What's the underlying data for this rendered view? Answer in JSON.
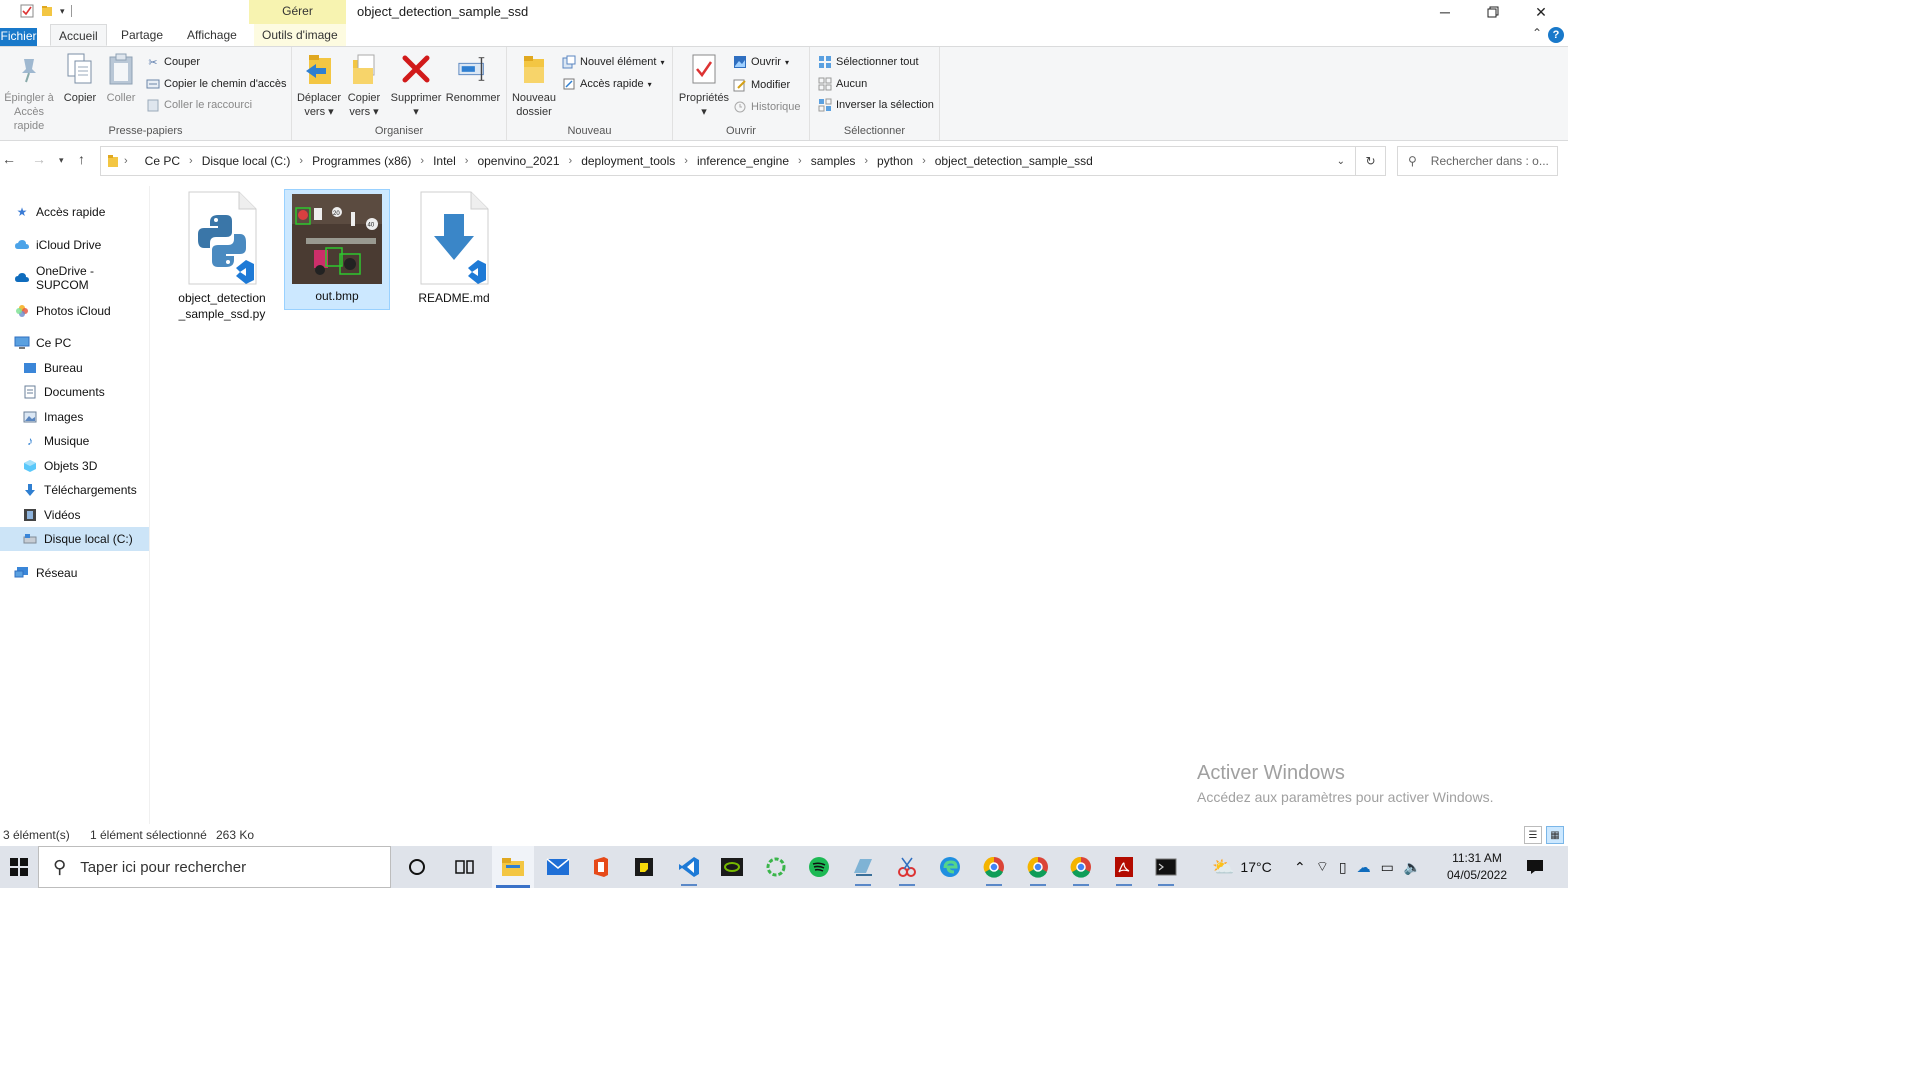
{
  "titlebar": {
    "manage_tab": "Gérer",
    "title": "object_detection_sample_ssd"
  },
  "tabs": {
    "file": "Fichier",
    "home": "Accueil",
    "share": "Partage",
    "view": "Affichage",
    "image_tools": "Outils d'image"
  },
  "ribbon": {
    "clipboard": {
      "label": "Presse-papiers",
      "pin_line1": "Épingler à",
      "pin_line2": "Accès rapide",
      "copy": "Copier",
      "paste": "Coller",
      "cut": "Couper",
      "copy_path": "Copier le chemin d'accès",
      "paste_shortcut": "Coller le raccourci"
    },
    "organize": {
      "label": "Organiser",
      "move_line1": "Déplacer",
      "move_line2": "vers",
      "copy_line1": "Copier",
      "copy_line2": "vers",
      "delete": "Supprimer",
      "rename": "Renommer"
    },
    "new": {
      "label": "Nouveau",
      "new_folder_line1": "Nouveau",
      "new_folder_line2": "dossier",
      "new_item": "Nouvel élément",
      "easy_access": "Accès rapide"
    },
    "open": {
      "label": "Ouvrir",
      "properties": "Propriétés",
      "open": "Ouvrir",
      "edit": "Modifier",
      "history": "Historique"
    },
    "select": {
      "label": "Sélectionner",
      "select_all": "Sélectionner tout",
      "select_none": "Aucun",
      "invert": "Inverser la sélection"
    }
  },
  "address": {
    "crumbs": [
      "Ce PC",
      "Disque local (C:)",
      "Programmes (x86)",
      "Intel",
      "openvino_2021",
      "deployment_tools",
      "inference_engine",
      "samples",
      "python",
      "object_detection_sample_ssd"
    ],
    "search_placeholder": "Rechercher dans : o..."
  },
  "navpane": {
    "quick_access": "Accès rapide",
    "icloud_drive": "iCloud Drive",
    "onedrive": "OneDrive - SUPCOM",
    "icloud_photos": "Photos iCloud",
    "this_pc": "Ce PC",
    "desktop": "Bureau",
    "documents": "Documents",
    "pictures": "Images",
    "music": "Musique",
    "objects3d": "Objets 3D",
    "downloads": "Téléchargements",
    "videos": "Vidéos",
    "local_disk": "Disque local (C:)",
    "network": "Réseau"
  },
  "files": [
    {
      "name_line1": "object_detection",
      "name_line2": "_sample_ssd.py"
    },
    {
      "name_line1": "out.bmp",
      "name_line2": ""
    },
    {
      "name_line1": "README.md",
      "name_line2": ""
    }
  ],
  "thumbnail_labels": [
    "20",
    "40"
  ],
  "watermark": {
    "line1": "Activer Windows",
    "line2": "Accédez aux paramètres pour activer Windows."
  },
  "status": {
    "count": "3 élément(s)",
    "selected": "1 élément sélectionné",
    "size": "263 Ko"
  },
  "taskbar": {
    "search_placeholder": "Taper ici pour rechercher",
    "temperature": "17°C",
    "time": "11:31 AM",
    "date": "04/05/2022"
  },
  "colors": {
    "accent": "#1979ca",
    "selection": "#cce8ff",
    "delete_red": "#d11a1a"
  }
}
